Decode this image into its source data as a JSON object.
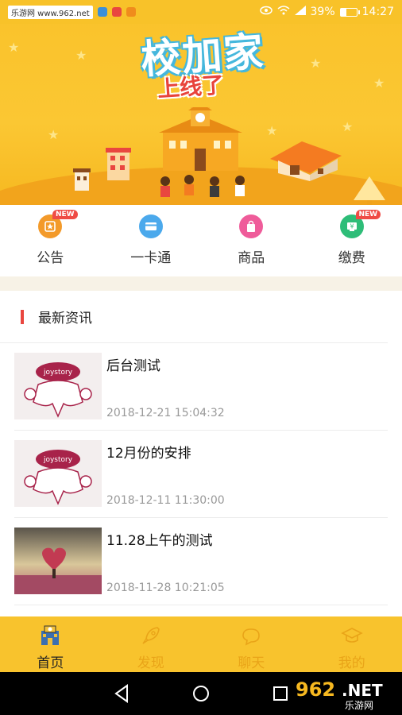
{
  "status_bar": {
    "watermark": "乐游网 www.962.net",
    "battery": "39%",
    "battery_level": 0.39,
    "time": "14:27"
  },
  "banner": {
    "title": "校加家",
    "subtitle": "上线了"
  },
  "quick_menu": [
    {
      "label": "公告",
      "icon": "notice-icon",
      "color": "#f39a2a",
      "badge": "NEW"
    },
    {
      "label": "一卡通",
      "icon": "card-icon",
      "color": "#4ba9ec",
      "badge": ""
    },
    {
      "label": "商品",
      "icon": "shopping-bag-icon",
      "color": "#ef5c9a",
      "badge": ""
    },
    {
      "label": "缴费",
      "icon": "payment-icon",
      "color": "#2ebd78",
      "badge": "NEW"
    }
  ],
  "news": {
    "header": "最新资讯",
    "items": [
      {
        "title": "后台测试",
        "date": "2018-12-21 15:04:32",
        "thumb": "joystory-logo"
      },
      {
        "title": "12月份的安排",
        "date": "2018-12-11 11:30:00",
        "thumb": "joystory-logo"
      },
      {
        "title": "11.28上午的测试",
        "date": "2018-11-28 10:21:05",
        "thumb": "heart-tree-photo"
      }
    ]
  },
  "tabs": [
    {
      "label": "首页",
      "icon": "school-icon",
      "active": true
    },
    {
      "label": "发现",
      "icon": "rocket-icon",
      "active": false
    },
    {
      "label": "聊天",
      "icon": "chat-icon",
      "active": false
    },
    {
      "label": "我的",
      "icon": "graduation-cap-icon",
      "active": false
    }
  ],
  "watermark_962": "962.NET 乐游网",
  "colors": {
    "accent": "#f8c32d",
    "badge": "#ef4b45",
    "inactive_tab": "#e9a418"
  }
}
